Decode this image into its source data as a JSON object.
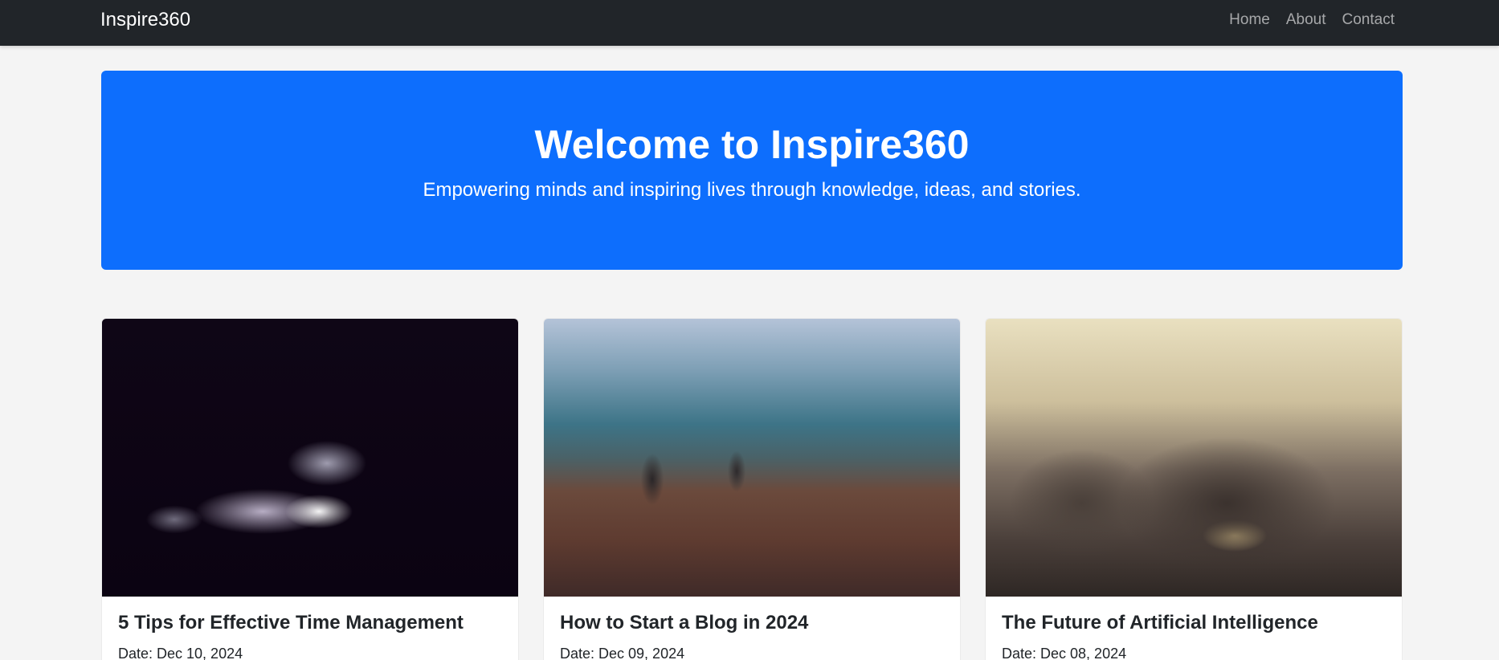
{
  "navbar": {
    "brand": "Inspire360",
    "links": [
      "Home",
      "About",
      "Contact"
    ]
  },
  "hero": {
    "title": "Welcome to Inspire360",
    "subtitle": "Empowering minds and inspiring lives through knowledge, ideas, and stories."
  },
  "posts": [
    {
      "title": "5 Tips for Effective Time Management",
      "date": "Date: Dec 10, 2024",
      "image": "smoke-in-dark-photo"
    },
    {
      "title": "How to Start a Blog in 2024",
      "date": "Date: Dec 09, 2024",
      "image": "foggy-field-photo"
    },
    {
      "title": "The Future of Artificial Intelligence",
      "date": "Date: Dec 08, 2024",
      "image": "vintage-car-photo"
    }
  ],
  "colors": {
    "navbar_bg": "#212529",
    "hero_bg": "#0d6efd",
    "page_bg": "#f4f4f4"
  }
}
